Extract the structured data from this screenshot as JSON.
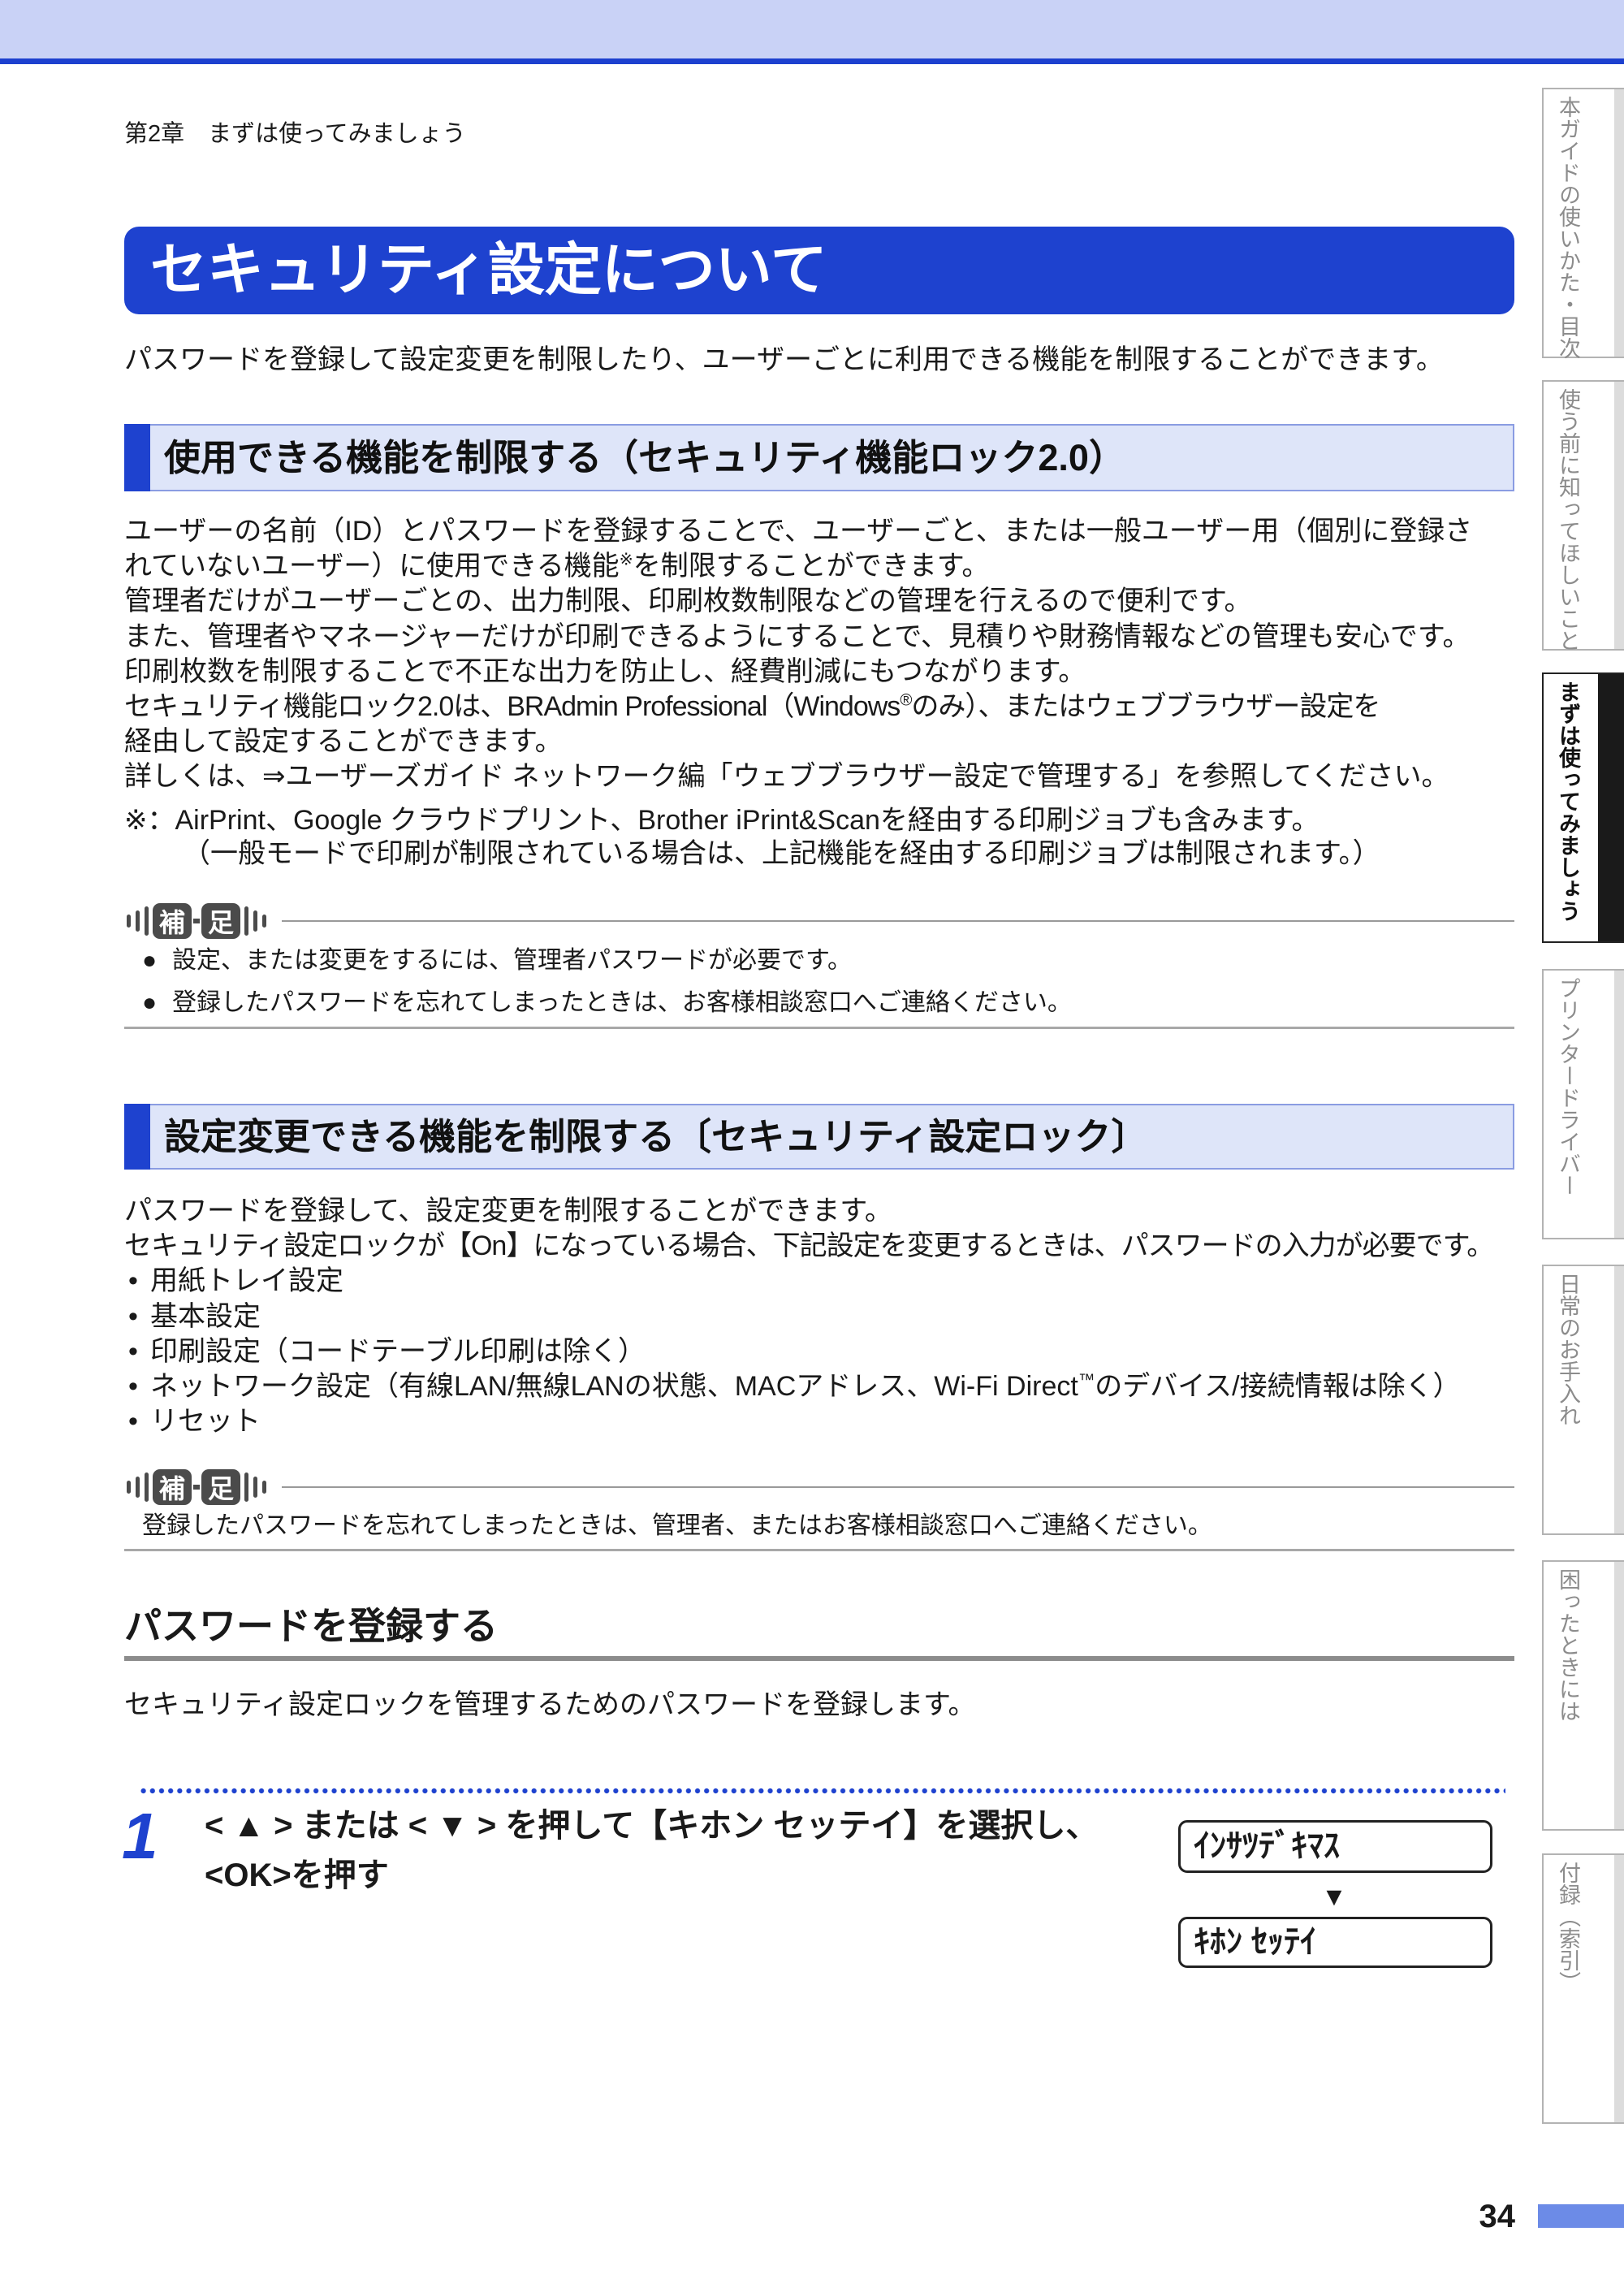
{
  "colors": {
    "header_band": "#c9d2f6",
    "header_line": "#1d40cf",
    "accent": "#1e42cf",
    "section_fill": "#dee5f9",
    "section_border": "#8a9ce2",
    "text": "#1a1a1a",
    "tab_text": "#8c8c8c",
    "tab_border": "#b3b3b3",
    "page_bar": "#6c8be7",
    "supplement_dark": "#4b4b4b"
  },
  "header": {
    "breadcrumb": "第2章　まずは使ってみましょう"
  },
  "title": "セキュリティ設定について",
  "intro": "パスワードを登録して設定変更を制限したり、ユーザーごとに利用できる機能を制限することができます。",
  "section_function_lock": {
    "heading": "使用できる機能を制限する（セキュリティ機能ロック2.0）",
    "lines": [
      {
        "text": "ユーザーの名前（ID）とパスワードを登録することで、ユーザーごと、または一般ユーザー用（個別に登録さ"
      },
      {
        "pre": "れていないユーザー）に使用できる機能",
        "sup": "※",
        "post": "を制限することができます。"
      },
      {
        "text": "管理者だけがユーザーごとの、出力制限、印刷枚数制限などの管理を行えるので便利です。"
      },
      {
        "text": "また、管理者やマネージャーだけが印刷できるようにすることで、見積りや財務情報などの管理も安心です。"
      },
      {
        "text": "印刷枚数を制限することで不正な出力を防止し、経費削減にもつながります。"
      },
      {
        "pre": "セキュリティ機能ロック2.0は、BRAdmin Professional（Windows",
        "sup": "®",
        "post": "のみ）、またはウェブブラウザー設定を"
      },
      {
        "text": "経由して設定することができます。"
      },
      {
        "text": "詳しくは、⇒ユーザーズガイド ネットワーク編「ウェブブラウザー設定で管理する」を参照してください。"
      }
    ],
    "footnote": [
      "※：AirPrint、Google クラウドプリント、Brother iPrint&Scanを経由する印刷ジョブも含みます。",
      "（一般モードで印刷が制限されている場合は、上記機能を経由する印刷ジョブは制限されます。）"
    ],
    "supplement": {
      "label_1": "補",
      "label_2": "足",
      "bullet": "●",
      "items": [
        "設定、または変更をするには、管理者パスワードが必要です。",
        "登録したパスワードを忘れてしまったときは、お客様相談窓口へご連絡ください。"
      ]
    }
  },
  "section_setting_lock": {
    "heading": "設定変更できる機能を制限する〔セキュリティ設定ロック〕",
    "lines": [
      "パスワードを登録して、設定変更を制限することができます。",
      "セキュリティ設定ロックが【On】になっている場合、下記設定を変更するときは、パスワードの入力が必要です。"
    ],
    "bullet": "•",
    "list": [
      "用紙トレイ設定",
      "基本設定",
      "印刷設定（コードテーブル印刷は除く）",
      {
        "pre": "ネットワーク設定（有線LAN/無線LANの状態、MACアドレス、Wi-Fi Direct",
        "sup": "™",
        "post": "のデバイス/接続情報は除く）"
      },
      "リセット"
    ],
    "supplement": {
      "label_1": "補",
      "label_2": "足",
      "text": "登録したパスワードを忘れてしまったときは、管理者、またはお客様相談窓口へご連絡ください。"
    }
  },
  "password_section": {
    "heading": "パスワードを登録する",
    "description": "セキュリティ設定ロックを管理するためのパスワードを登録します。",
    "step": {
      "number": "1",
      "line_1": "< ▲ > または < ▼ > を押して【キホン セッテイ】を選択し、",
      "line_2": "<OK>を押す"
    },
    "lcd": {
      "screen_1": "ｲﾝｻﾂﾃﾞｷﾏｽ",
      "arrow": "▼",
      "screen_2": "ｷﾎﾝ ｾｯﾃｲ"
    }
  },
  "side_tabs": [
    {
      "label": "本ガイドの使いかた・目次",
      "active": false
    },
    {
      "label": "使う前に知ってほしいこと",
      "active": false
    },
    {
      "label": "まずは使ってみましょう",
      "active": true
    },
    {
      "label": "プリンタードライバー",
      "active": false
    },
    {
      "label": "日常のお手入れ",
      "active": false
    },
    {
      "label": "困ったときには",
      "active": false
    },
    {
      "label": "付録（索引）",
      "active": false
    }
  ],
  "page_number": "34"
}
